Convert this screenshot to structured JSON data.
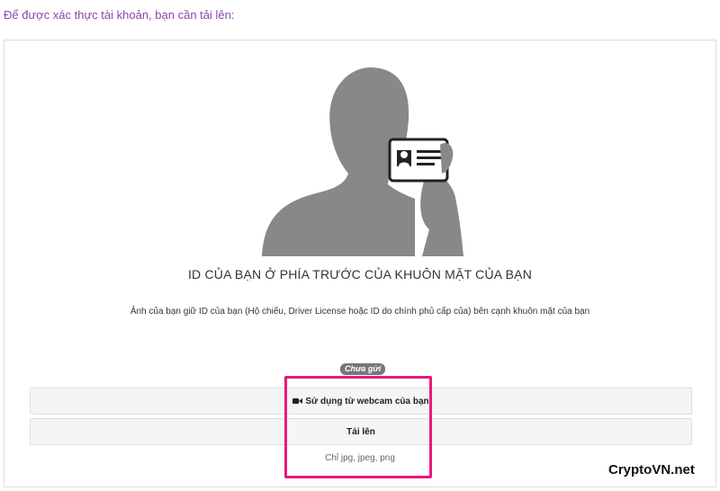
{
  "intro_text": "Để được xác thực tài khoản, bạn cần tải lên:",
  "verification": {
    "title": "ID CỦA BẠN Ở PHÍA TRƯỚC CỦA KHUÔN MẶT CỦA BẠN",
    "description": "Ảnh của bạn giữ ID của bạn (Hộ chiếu, Driver License hoặc ID do chính phủ cấp của) bên cạnh khuôn mặt của bạn",
    "status_badge": "Chưa gửi",
    "webcam_button_label": "Sử dụng từ webcam của bạn",
    "webcam_icon": "video-camera-icon",
    "upload_button_label": "Tải lên",
    "file_types_hint": "Chỉ jpg, jpeg, png"
  },
  "illustration_icon": "person-holding-id-card-icon",
  "highlight_color": "#e8197a",
  "watermark": "CryptoVN.net"
}
